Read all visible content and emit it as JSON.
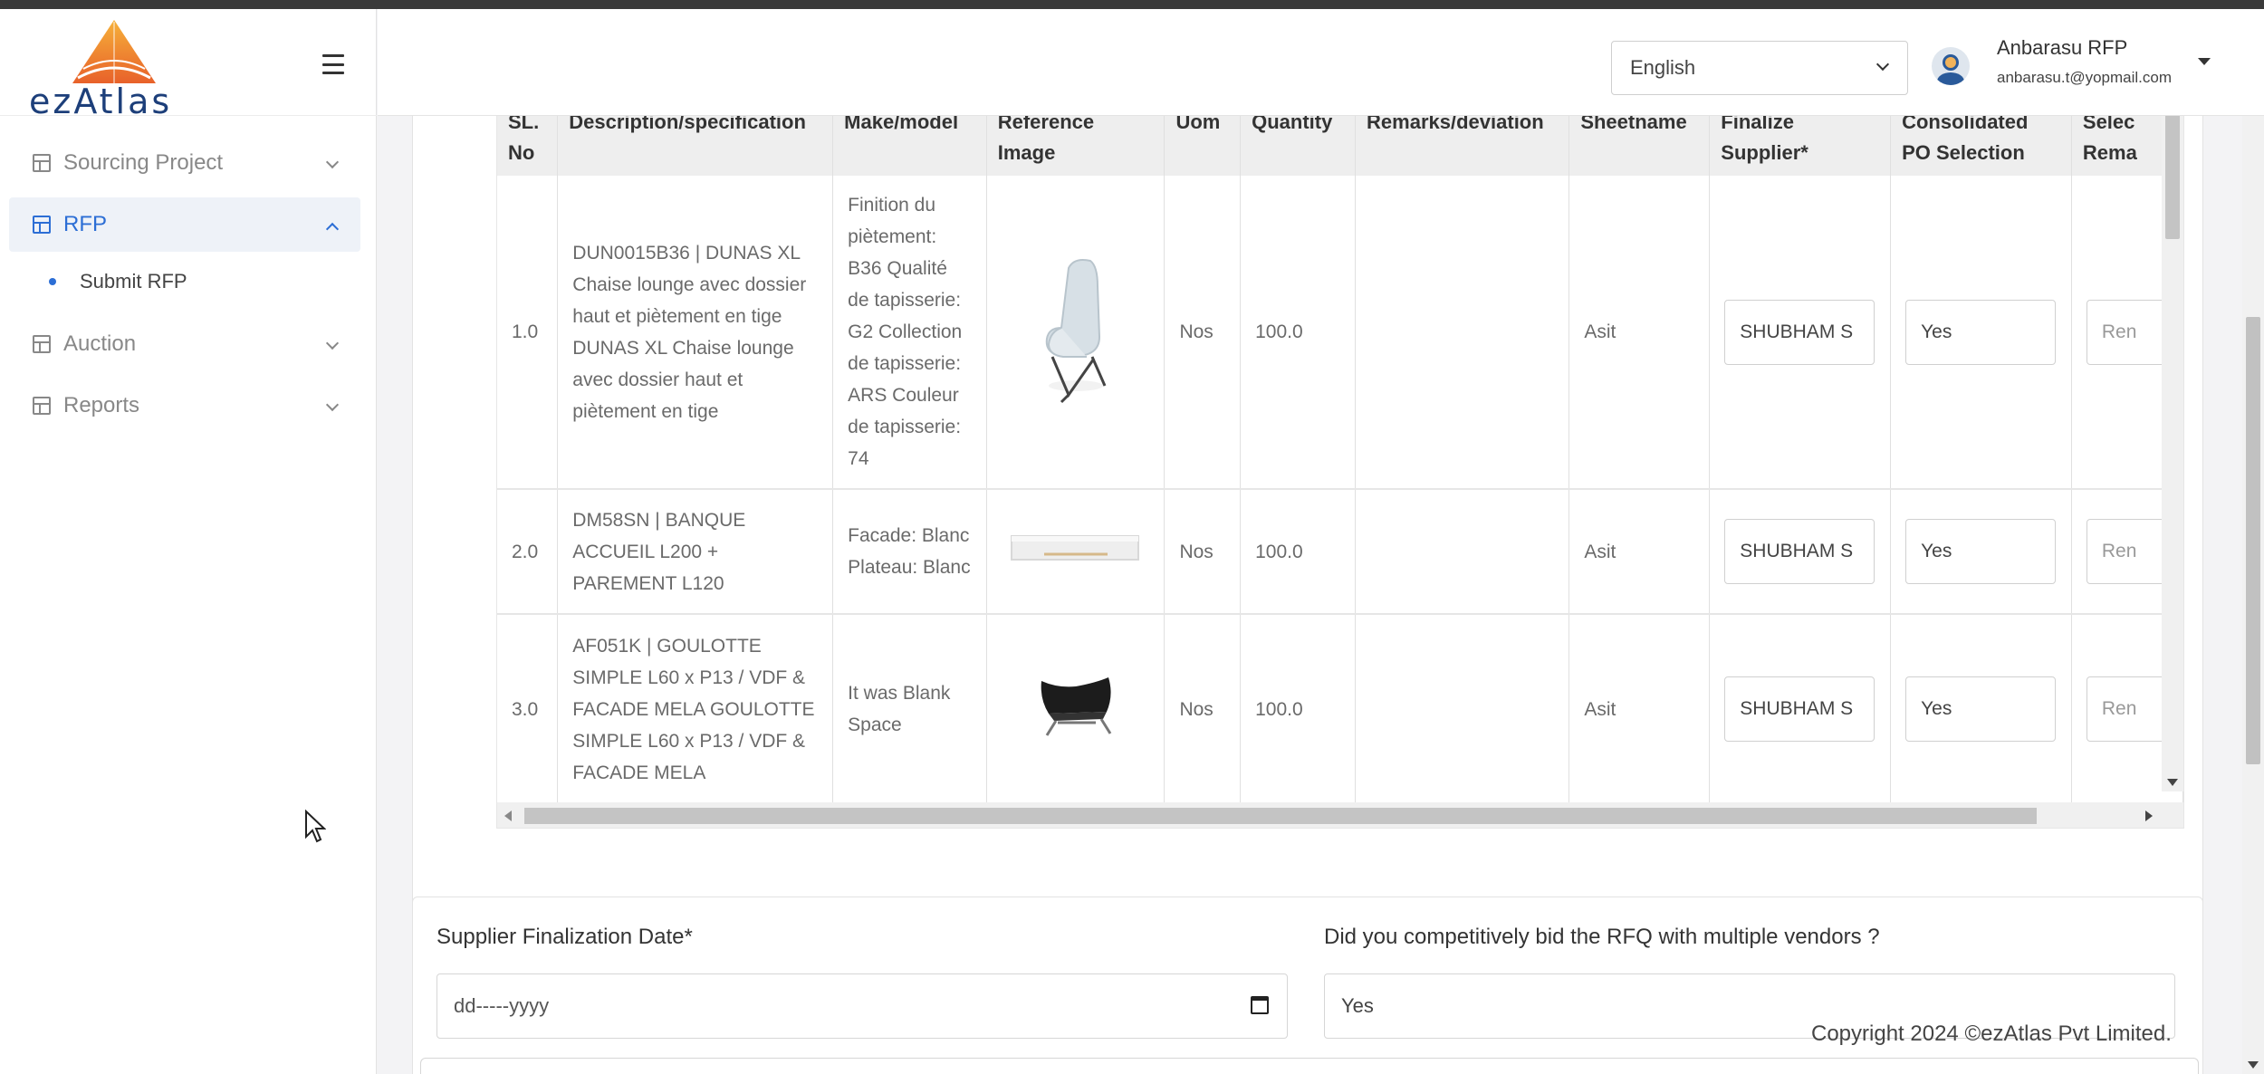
{
  "brand": {
    "logo_text": "ezAtlas"
  },
  "sidebar": {
    "items": [
      {
        "label": "Sourcing Project"
      },
      {
        "label": "RFP"
      },
      {
        "label": "Auction"
      },
      {
        "label": "Reports"
      }
    ],
    "sub_items": [
      {
        "label": "Submit RFP"
      }
    ]
  },
  "header": {
    "language": "English",
    "user_name": "Anbarasu RFP",
    "user_email": "anbarasu.t@yopmail.com"
  },
  "table": {
    "headers": [
      "SL. No",
      "Description/specification",
      "Make/model",
      "Reference Image",
      "Uom",
      "Quantity",
      "Remarks/deviation",
      "Sheetname",
      "Finalize Supplier*",
      "Consolidated PO Selection",
      "Selec Rema"
    ],
    "rows": [
      {
        "sl": "1.0",
        "description": "DUN0015B36 | DUNAS XL Chaise lounge avec dossier haut et piètement en tige DUNAS XL Chaise lounge avec dossier haut et piètement en tige",
        "make": "Finition du piètement: B36 Qualité de tapisserie: G2 Collection de tapisserie: ARS Couleur de tapisserie: 74",
        "image": "lounge-chair-image",
        "uom": "Nos",
        "quantity": "100.0",
        "remarks": "",
        "sheetname": "Asit",
        "supplier": "SHUBHAM S",
        "po": "Yes",
        "select_remarks": "Ren"
      },
      {
        "sl": "2.0",
        "description": "DM58SN | BANQUE ACCUEIL L200 + PAREMENT L120",
        "make": "Facade: Blanc Plateau: Blanc",
        "image": "reception-desk-image",
        "uom": "Nos",
        "quantity": "100.0",
        "remarks": "",
        "sheetname": "Asit",
        "supplier": "SHUBHAM S",
        "po": "Yes",
        "select_remarks": "Ren"
      },
      {
        "sl": "3.0",
        "description": "AF051K | GOULOTTE SIMPLE L60 x P13 / VDF & FACADE MELA GOULOTTE SIMPLE L60 x P13 / VDF & FACADE MELA",
        "make": "It was Blank Space",
        "image": "black-lounge-chair-image",
        "uom": "Nos",
        "quantity": "100.0",
        "remarks": "",
        "sheetname": "Asit",
        "supplier": "SHUBHAM S",
        "po": "Yes",
        "select_remarks": "Ren"
      }
    ]
  },
  "form": {
    "date_label": "Supplier Finalization Date*",
    "date_placeholder": "dd-----yyyy",
    "bid_label": "Did you competitively bid the RFQ with multiple vendors ?",
    "bid_value": "Yes"
  },
  "footer": {
    "copyright": "Copyright 2024 ©ezAtlas Pvt Limited."
  },
  "colors": {
    "accent": "#2c6ed5",
    "logo_blue": "#1d3f7a",
    "logo_orange": "#f08a24"
  }
}
